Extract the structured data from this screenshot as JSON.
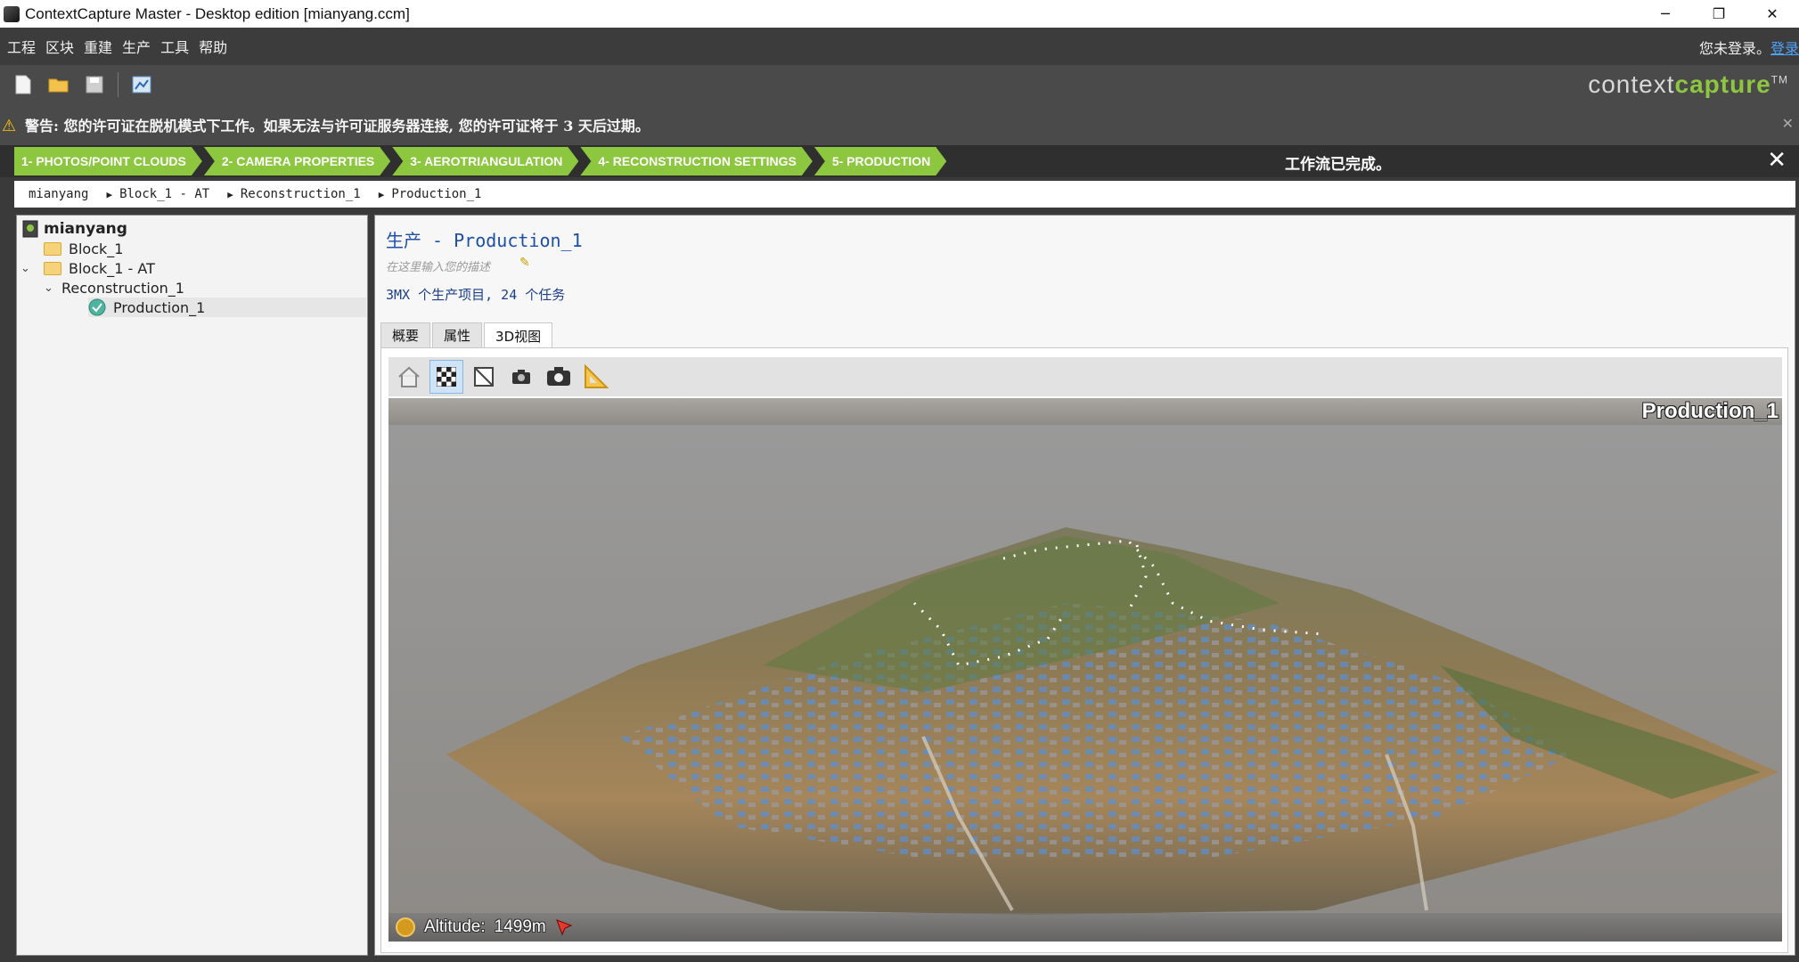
{
  "window": {
    "title": "ContextCapture Master - Desktop edition [mianyang.ccm]",
    "minimize": "─",
    "restore": "❐",
    "close": "✕"
  },
  "menu": {
    "items": [
      "工程",
      "区块",
      "重建",
      "生产",
      "工具",
      "帮助"
    ],
    "login_text": "您未登录。",
    "login_link": "登录"
  },
  "toolbar": {
    "buttons": [
      "new-project-icon",
      "open-project-icon",
      "save-project-icon",
      "settings-icon"
    ],
    "brand_prefix": "context",
    "brand_accent": "capture",
    "brand_tm": "TM",
    "accent_color": "#8dc63f"
  },
  "warning": {
    "icon": "⚠",
    "text": "警告: 您的许可证在脱机模式下工作。如果无法与许可证服务器连接, 您的许可证将于 3 天后过期。",
    "close": "✕"
  },
  "wizard": {
    "steps": [
      "1- PHOTOS/POINT CLOUDS",
      "2- CAMERA PROPERTIES",
      "3- AEROTRIANGULATION",
      "4- RECONSTRUCTION SETTINGS",
      "5- PRODUCTION"
    ],
    "status": "工作流已完成。",
    "close": "✕"
  },
  "breadcrumb": [
    "mianyang",
    "Block_1 - AT",
    "Reconstruction_1",
    "Production_1"
  ],
  "tree": {
    "root": "mianyang",
    "block1": "Block_1",
    "block1at": "Block_1 - AT",
    "reconstruction": "Reconstruction_1",
    "production": "Production_1"
  },
  "main": {
    "title": "生产 - Production_1",
    "description_placeholder": "在这里输入您的描述",
    "summary": "3MX 个生产项目, 24 个任务",
    "tabs": [
      "概要",
      "属性",
      "3D视图"
    ],
    "active_tab": "3D视图"
  },
  "viewer": {
    "tools": [
      "home-icon",
      "checker-texture-icon",
      "wireframe-icon",
      "screenshot-icon",
      "camera-icon",
      "measure-icon"
    ],
    "title": "Production_1",
    "altitude_label": "Altitude:",
    "altitude_value": "1499m"
  }
}
